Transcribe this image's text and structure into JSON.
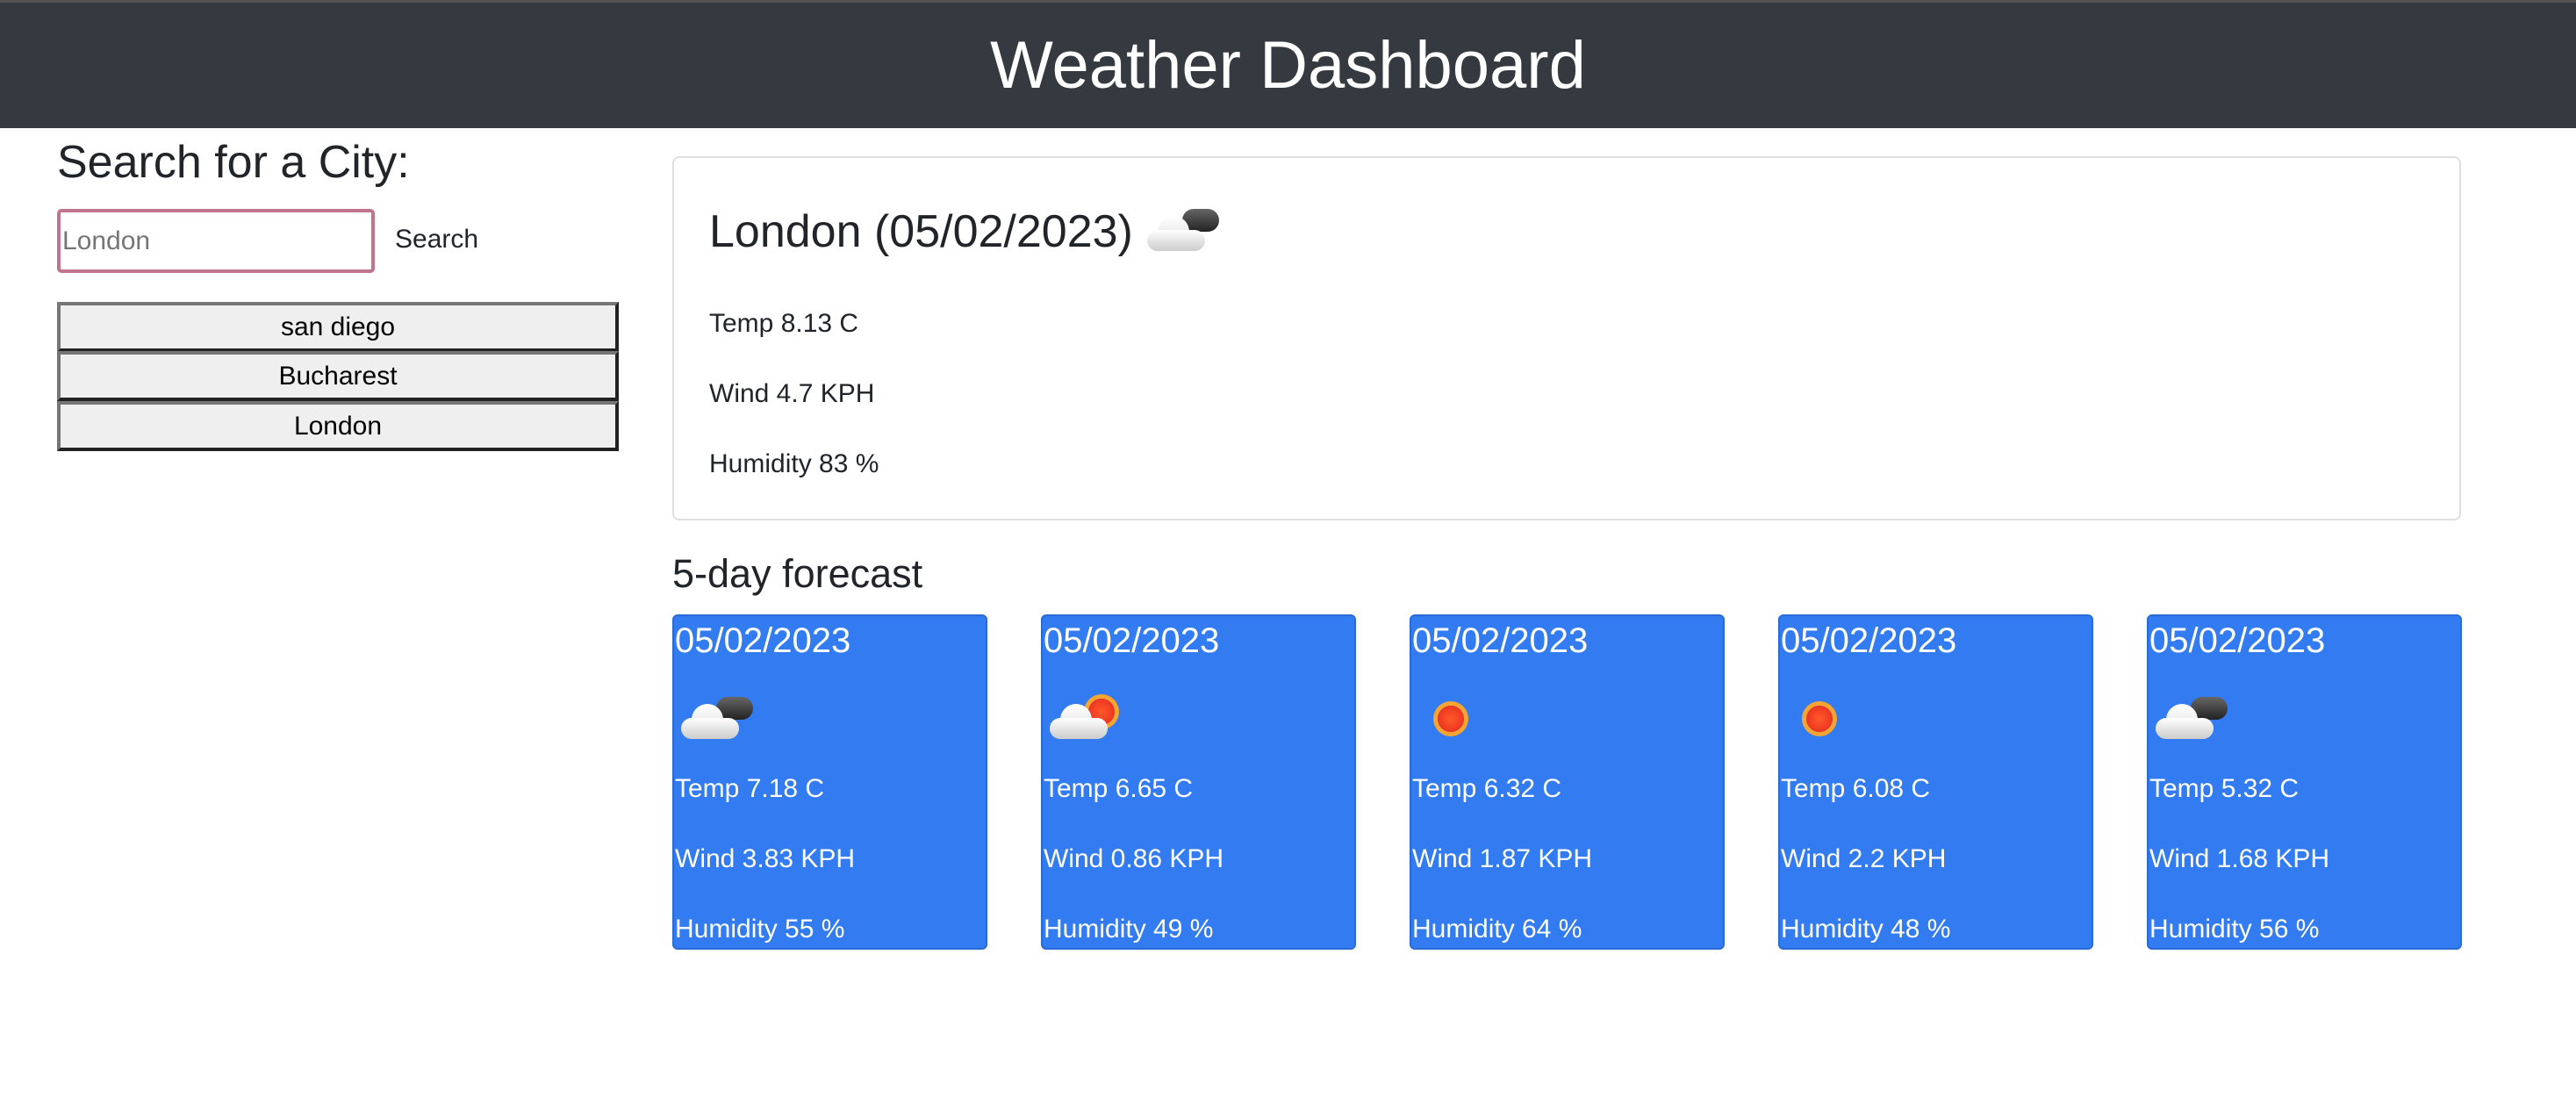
{
  "header": {
    "title": "Weather Dashboard"
  },
  "search": {
    "heading": "Search for a City:",
    "placeholder": "London",
    "button_label": "Search"
  },
  "history": [
    "san diego",
    "Bucharest",
    "London"
  ],
  "current": {
    "city_date": "London (05/02/2023)",
    "icon": "cloudy-icon",
    "temp": "Temp 8.13 C",
    "wind": "Wind 4.7 KPH",
    "humidity": "Humidity 83 %"
  },
  "forecast": {
    "heading": "5-day forecast",
    "days": [
      {
        "date": "05/02/2023",
        "icon": "cloudy-icon",
        "temp": "Temp 7.18 C",
        "wind": "Wind 3.83 KPH",
        "humidity": "Humidity 55 %"
      },
      {
        "date": "05/02/2023",
        "icon": "partly-sunny-icon",
        "temp": "Temp 6.65 C",
        "wind": "Wind 0.86 KPH",
        "humidity": "Humidity 49 %"
      },
      {
        "date": "05/02/2023",
        "icon": "sun-icon",
        "temp": "Temp 6.32 C",
        "wind": "Wind 1.87 KPH",
        "humidity": "Humidity 64 %"
      },
      {
        "date": "05/02/2023",
        "icon": "sun-icon",
        "temp": "Temp 6.08 C",
        "wind": "Wind 2.2 KPH",
        "humidity": "Humidity 48 %"
      },
      {
        "date": "05/02/2023",
        "icon": "cloudy-icon",
        "temp": "Temp 5.32 C",
        "wind": "Wind 1.68 KPH",
        "humidity": "Humidity 56 %"
      }
    ]
  }
}
